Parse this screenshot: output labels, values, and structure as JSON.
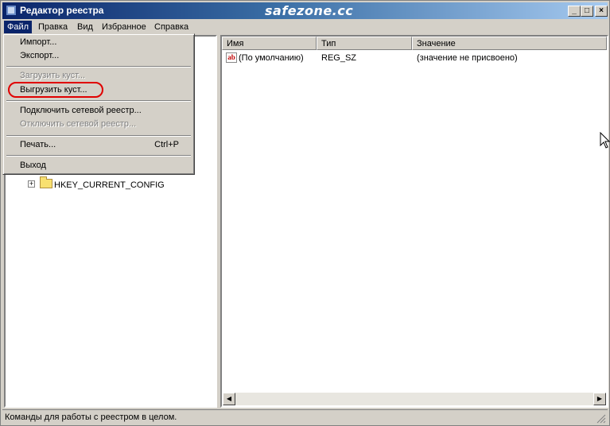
{
  "window": {
    "title": "Редактор реестра",
    "watermark": "safezone.cc"
  },
  "titlebar_buttons": {
    "minimize": "_",
    "maximize": "□",
    "close": "×"
  },
  "menubar": {
    "items": [
      {
        "label": "Файл"
      },
      {
        "label": "Правка"
      },
      {
        "label": "Вид"
      },
      {
        "label": "Избранное"
      },
      {
        "label": "Справка"
      }
    ]
  },
  "file_menu": {
    "items": [
      {
        "label": "Импорт...",
        "enabled": true
      },
      {
        "label": "Экспорт...",
        "enabled": true
      },
      {
        "label": "Загрузить куст...",
        "enabled": false
      },
      {
        "label": "Выгрузить куст...",
        "enabled": true,
        "highlighted": true
      },
      {
        "label": "Подключить сетевой реестр...",
        "enabled": true
      },
      {
        "label": "Отключить сетевой реестр...",
        "enabled": false
      },
      {
        "label": "Печать...",
        "enabled": true,
        "shortcut": "Ctrl+P"
      },
      {
        "label": "Выход",
        "enabled": true
      }
    ]
  },
  "tree": {
    "visible_key": "HKEY_CURRENT_CONFIG",
    "expander": "+"
  },
  "list": {
    "columns": [
      "Имя",
      "Тип",
      "Значение"
    ],
    "rows": [
      {
        "name": "(По умолчанию)",
        "type": "REG_SZ",
        "value": "(значение не присвоено)",
        "icon": "ab"
      }
    ]
  },
  "statusbar": {
    "text": "Команды для работы с реестром в целом."
  },
  "colors": {
    "title_start": "#0a246a",
    "title_end": "#a6caf0",
    "face": "#d4d0c8",
    "highlight_ring": "#e00000"
  }
}
